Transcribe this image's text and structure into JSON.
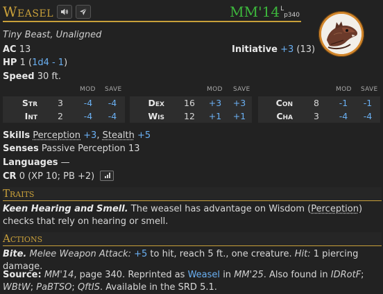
{
  "creature": {
    "name": "Weasel",
    "source_abbr": "MM'14",
    "source_superscript": "L",
    "source_page": "p340",
    "size_type": "Tiny Beast, Unaligned",
    "ac_label": "AC",
    "ac_value": "13",
    "initiative_label": "Initiative",
    "initiative_mod": "+3",
    "initiative_score": "(13)",
    "hp_label": "HP",
    "hp_value": "1",
    "hp_open": "(",
    "hp_formula": "1d4 - 1",
    "hp_close": ")",
    "speed_label": "Speed",
    "speed_value": "30 ft."
  },
  "ability_headers": {
    "mod": "MOD",
    "save": "SAVE"
  },
  "abilities": [
    [
      {
        "name": "Str",
        "score": "3",
        "mod": "-4",
        "save": "-4"
      },
      {
        "name": "Int",
        "score": "2",
        "mod": "-4",
        "save": "-4"
      }
    ],
    [
      {
        "name": "Dex",
        "score": "16",
        "mod": "+3",
        "save": "+3"
      },
      {
        "name": "Wis",
        "score": "12",
        "mod": "+1",
        "save": "+1"
      }
    ],
    [
      {
        "name": "Con",
        "score": "8",
        "mod": "-1",
        "save": "-1"
      },
      {
        "name": "Cha",
        "score": "3",
        "mod": "-4",
        "save": "-4"
      }
    ]
  ],
  "details": {
    "skills_label": "Skills",
    "skill1_name": "Perception",
    "skill1_mod": "+3",
    "skill_sep": ",",
    "skill2_name": "Stealth",
    "skill2_mod": "+5",
    "senses_label": "Senses",
    "senses_value": "Passive Perception 13",
    "languages_label": "Languages",
    "languages_value": "—",
    "cr_label": "CR",
    "cr_value": "0 (XP 10; PB +2)"
  },
  "traits": {
    "heading": "Traits",
    "name": "Keen Hearing and Smell.",
    "text_a": "The weasel has advantage on Wisdom (",
    "text_link": "Perception",
    "text_b": ") checks that rely on hearing or smell."
  },
  "actions": {
    "heading": "Actions",
    "name": "Bite.",
    "attack_type": "Melee Weapon Attack:",
    "to_hit": "+5",
    "text_a": "to hit, reach 5 ft., one creature.",
    "hit_label": "Hit:",
    "text_b": "1 piercing damage."
  },
  "source_note": {
    "label": "Source:",
    "book": "MM'14",
    "text_a": ", page 340. Reprinted as",
    "reprint_link": "Weasel",
    "text_b": "in",
    "reprint_book": "MM'25",
    "text_c": ". Also found in",
    "book2": "IDRotF",
    "sep1": ";",
    "book3": "WBtW",
    "sep2": ";",
    "book4": "PaBTSO",
    "sep3": ";",
    "book5": "QftIS",
    "text_d": ". Available in the SRD 5.1."
  },
  "colors": {
    "background": "#222222",
    "accent_gold": "#c9a03a",
    "source_green": "#3db83d",
    "link_blue": "#6ab0f3",
    "row_bg": "#2d2d2d",
    "token_ring": "#d2862b"
  },
  "icons": [
    "speaker-icon",
    "send-icon",
    "bar-chart-icon",
    "weasel-token-image"
  ]
}
